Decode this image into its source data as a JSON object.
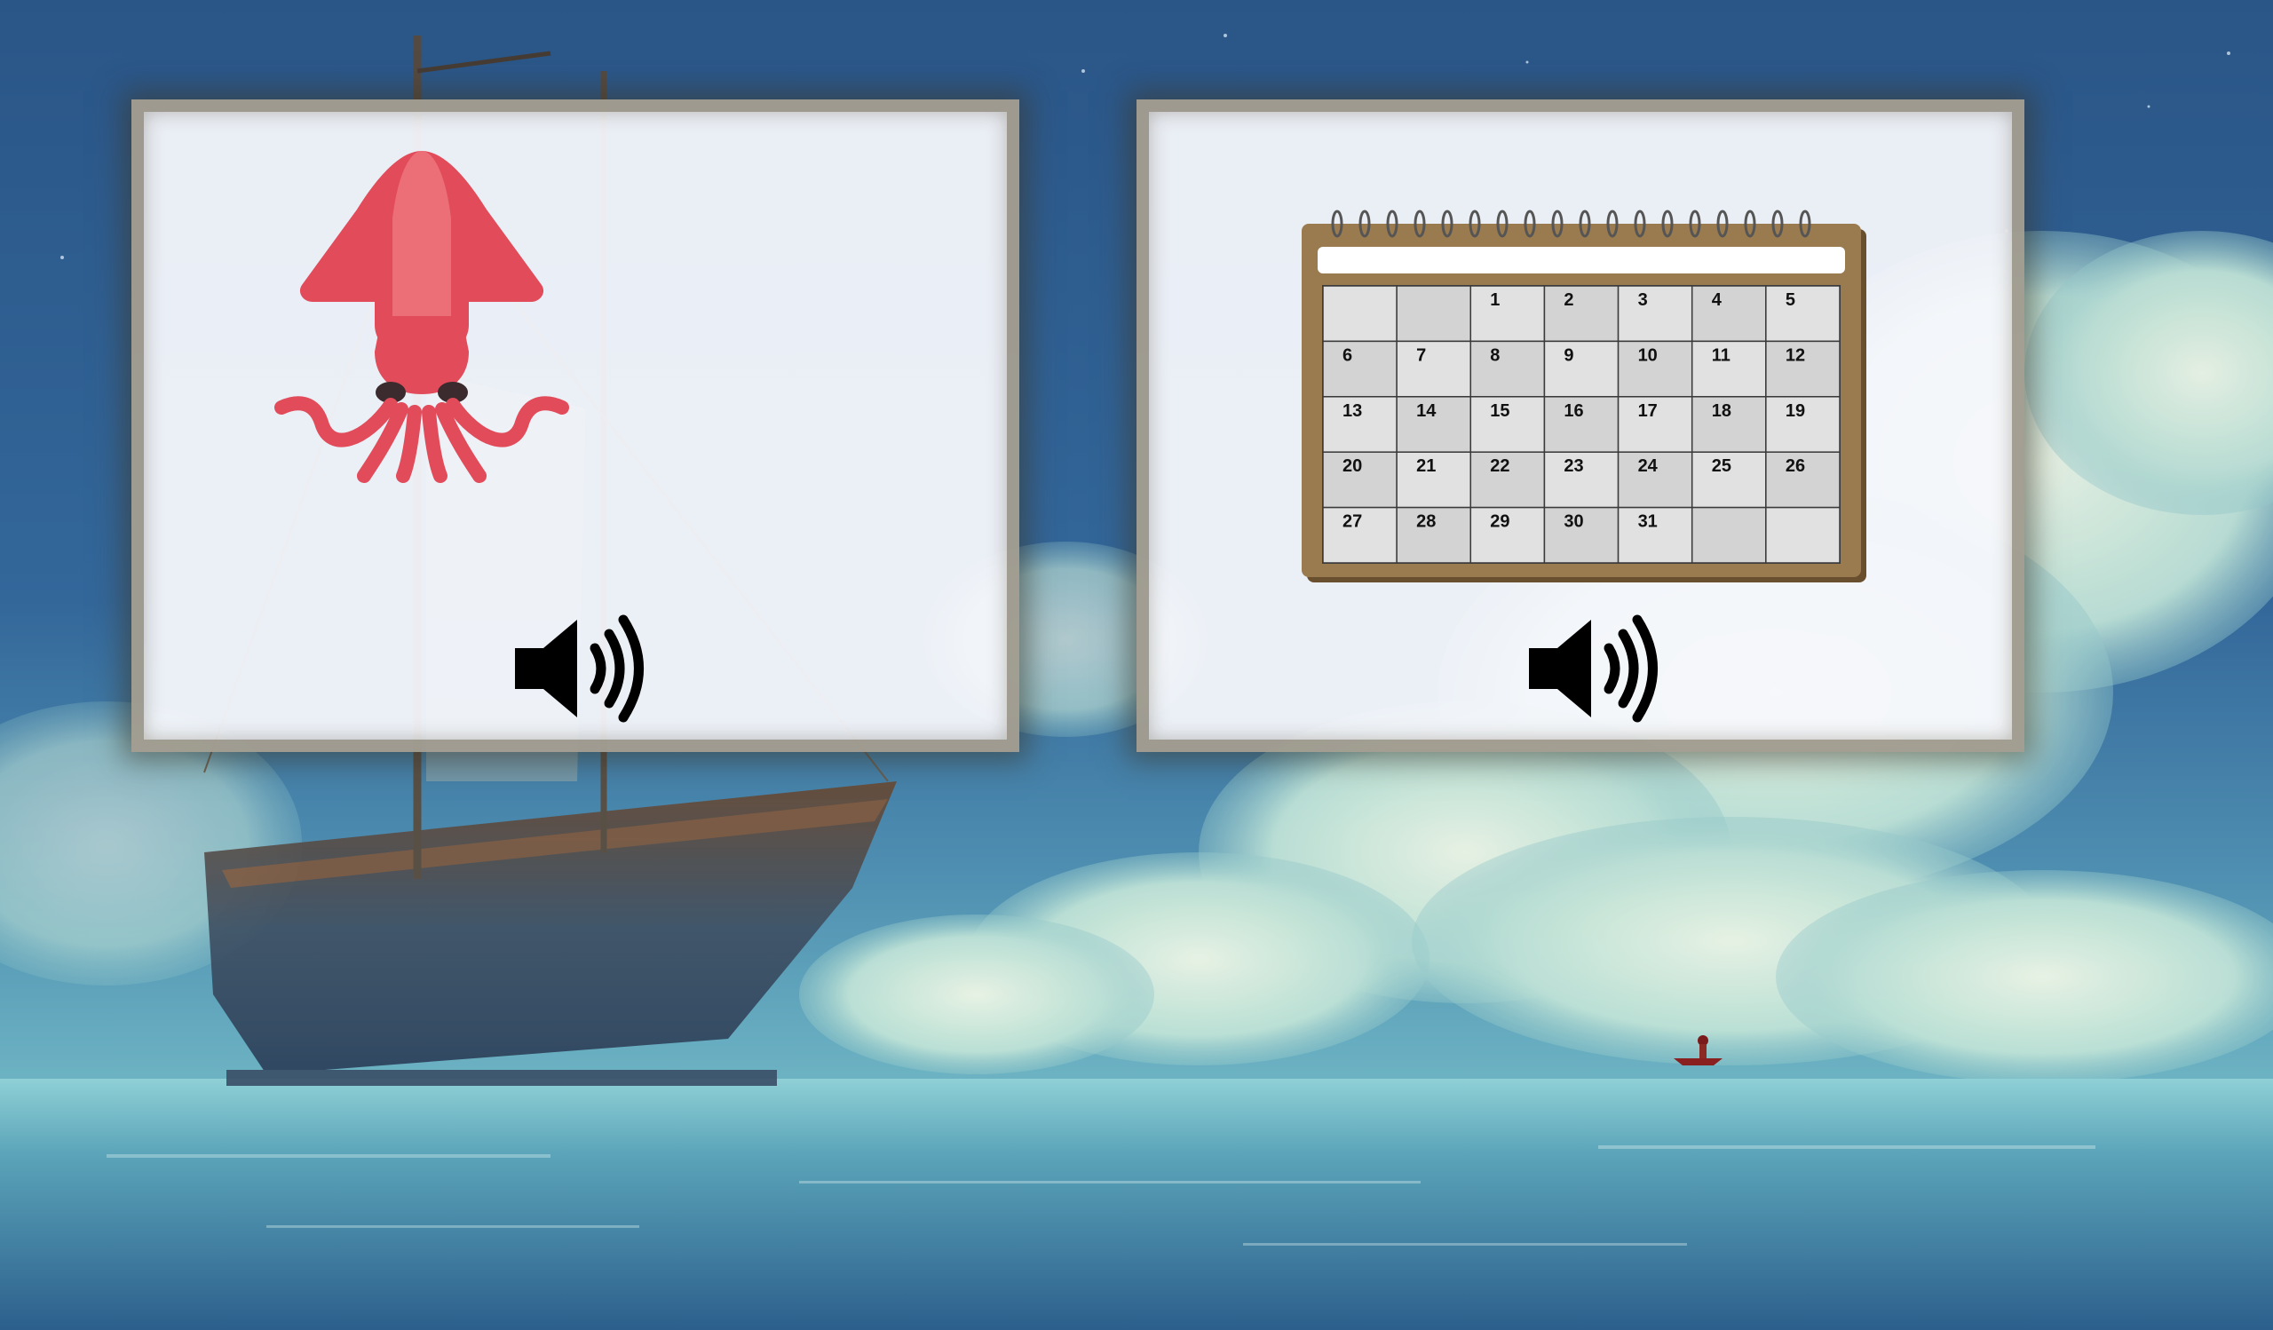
{
  "cards": [
    {
      "picture": "squid-icon",
      "audio": "speaker-icon",
      "colors": {
        "body": "#e14b5a",
        "highlight": "#ec6f77",
        "eyes": "#3b2a2e"
      }
    },
    {
      "picture": "calendar-icon",
      "audio": "speaker-icon",
      "colors": {
        "frame": "#9a7a4f",
        "page": "#d9d9d9",
        "grid": "#4a4a4a"
      },
      "calendar_days": [
        [
          "",
          "",
          "1",
          "2",
          "3",
          "4",
          "5"
        ],
        [
          "6",
          "7",
          "8",
          "9",
          "10",
          "11",
          "12"
        ],
        [
          "13",
          "14",
          "15",
          "16",
          "17",
          "18",
          "19"
        ],
        [
          "20",
          "21",
          "22",
          "23",
          "24",
          "25",
          "26"
        ],
        [
          "27",
          "28",
          "29",
          "30",
          "31",
          "",
          ""
        ]
      ]
    }
  ],
  "background": {
    "scene": "sailing-ship-on-sea",
    "colors": {
      "sky": "#2f5d8c",
      "cloud": "#a9d8d6",
      "sea": "#5fa8b8"
    }
  }
}
